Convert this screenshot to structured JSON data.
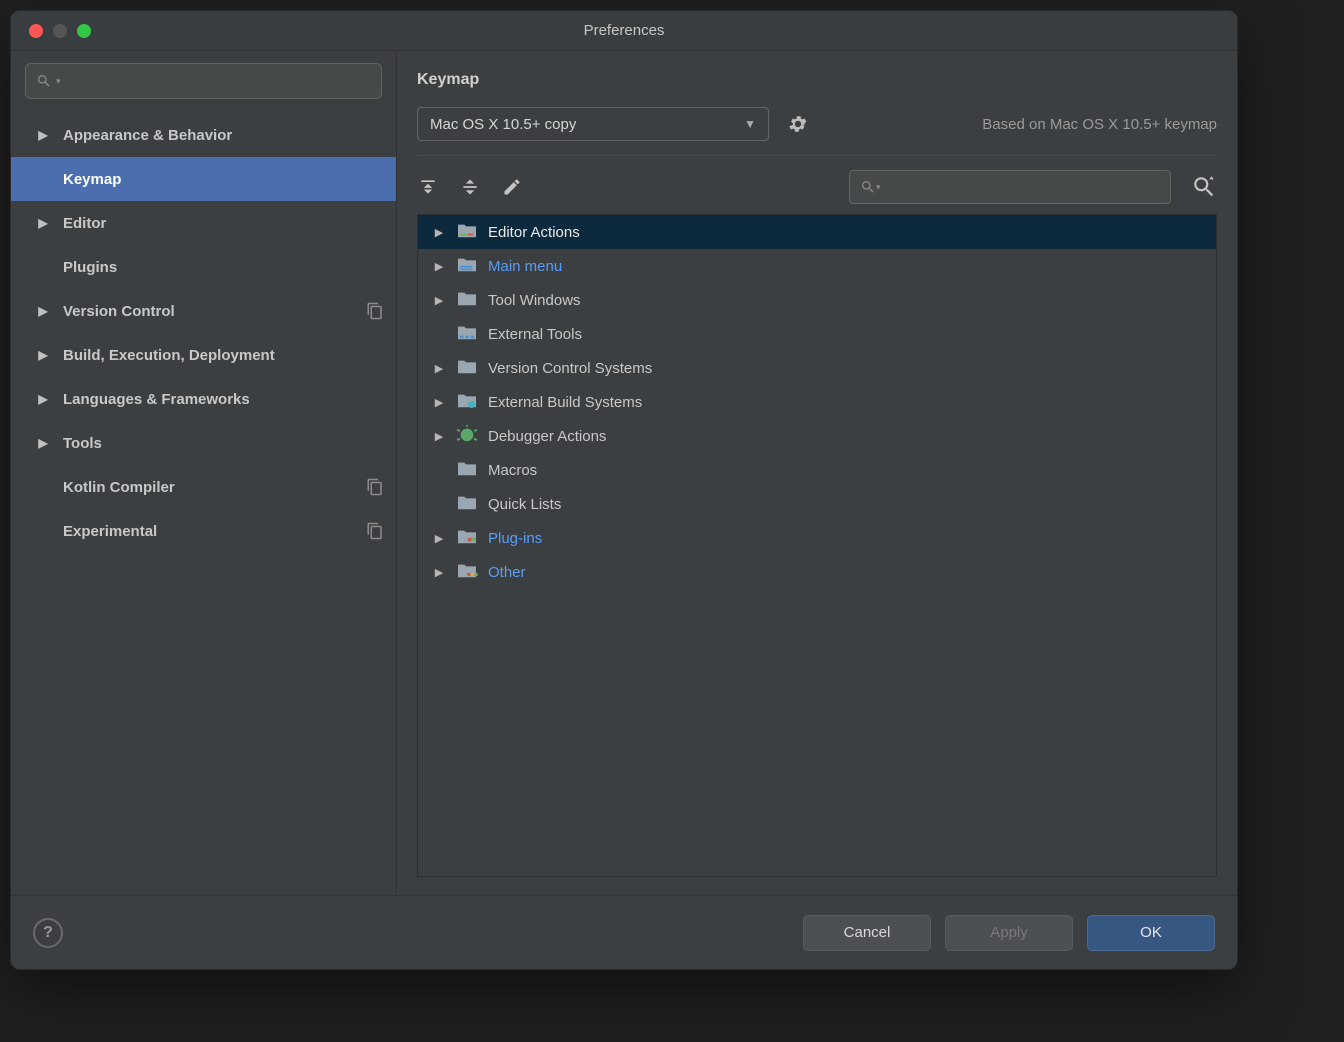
{
  "window": {
    "title": "Preferences"
  },
  "sidebar": {
    "search_placeholder": "",
    "items": [
      {
        "label": "Appearance & Behavior",
        "expandable": true,
        "selected": false,
        "copyable": false
      },
      {
        "label": "Keymap",
        "expandable": false,
        "selected": true,
        "copyable": false
      },
      {
        "label": "Editor",
        "expandable": true,
        "selected": false,
        "copyable": false
      },
      {
        "label": "Plugins",
        "expandable": false,
        "selected": false,
        "copyable": false
      },
      {
        "label": "Version Control",
        "expandable": true,
        "selected": false,
        "copyable": true
      },
      {
        "label": "Build, Execution, Deployment",
        "expandable": true,
        "selected": false,
        "copyable": false
      },
      {
        "label": "Languages & Frameworks",
        "expandable": true,
        "selected": false,
        "copyable": false
      },
      {
        "label": "Tools",
        "expandable": true,
        "selected": false,
        "copyable": false
      },
      {
        "label": "Kotlin Compiler",
        "expandable": false,
        "selected": false,
        "copyable": true
      },
      {
        "label": "Experimental",
        "expandable": false,
        "selected": false,
        "copyable": true
      }
    ]
  },
  "pane": {
    "title": "Keymap",
    "keymap_select": {
      "value": "Mac OS X 10.5+ copy"
    },
    "based_on": "Based on Mac OS X 10.5+ keymap",
    "tree_search_placeholder": "",
    "tree": [
      {
        "label": "Editor Actions",
        "icon": "editor",
        "expandable": true,
        "selected": true,
        "link": false
      },
      {
        "label": "Main menu",
        "icon": "menu",
        "expandable": true,
        "selected": false,
        "link": true
      },
      {
        "label": "Tool Windows",
        "icon": "folder",
        "expandable": true,
        "selected": false,
        "link": false
      },
      {
        "label": "External Tools",
        "icon": "ext",
        "expandable": false,
        "selected": false,
        "link": false
      },
      {
        "label": "Version Control Systems",
        "icon": "folder",
        "expandable": true,
        "selected": false,
        "link": false
      },
      {
        "label": "External Build Systems",
        "icon": "ebs",
        "expandable": true,
        "selected": false,
        "link": false
      },
      {
        "label": "Debugger Actions",
        "icon": "dbg",
        "expandable": true,
        "selected": false,
        "link": false
      },
      {
        "label": "Macros",
        "icon": "folder",
        "expandable": false,
        "selected": false,
        "link": false
      },
      {
        "label": "Quick Lists",
        "icon": "folder",
        "expandable": false,
        "selected": false,
        "link": false
      },
      {
        "label": "Plug-ins",
        "icon": "plug",
        "expandable": true,
        "selected": false,
        "link": true
      },
      {
        "label": "Other",
        "icon": "other",
        "expandable": true,
        "selected": false,
        "link": true
      }
    ]
  },
  "footer": {
    "cancel": "Cancel",
    "apply": "Apply",
    "ok": "OK"
  }
}
